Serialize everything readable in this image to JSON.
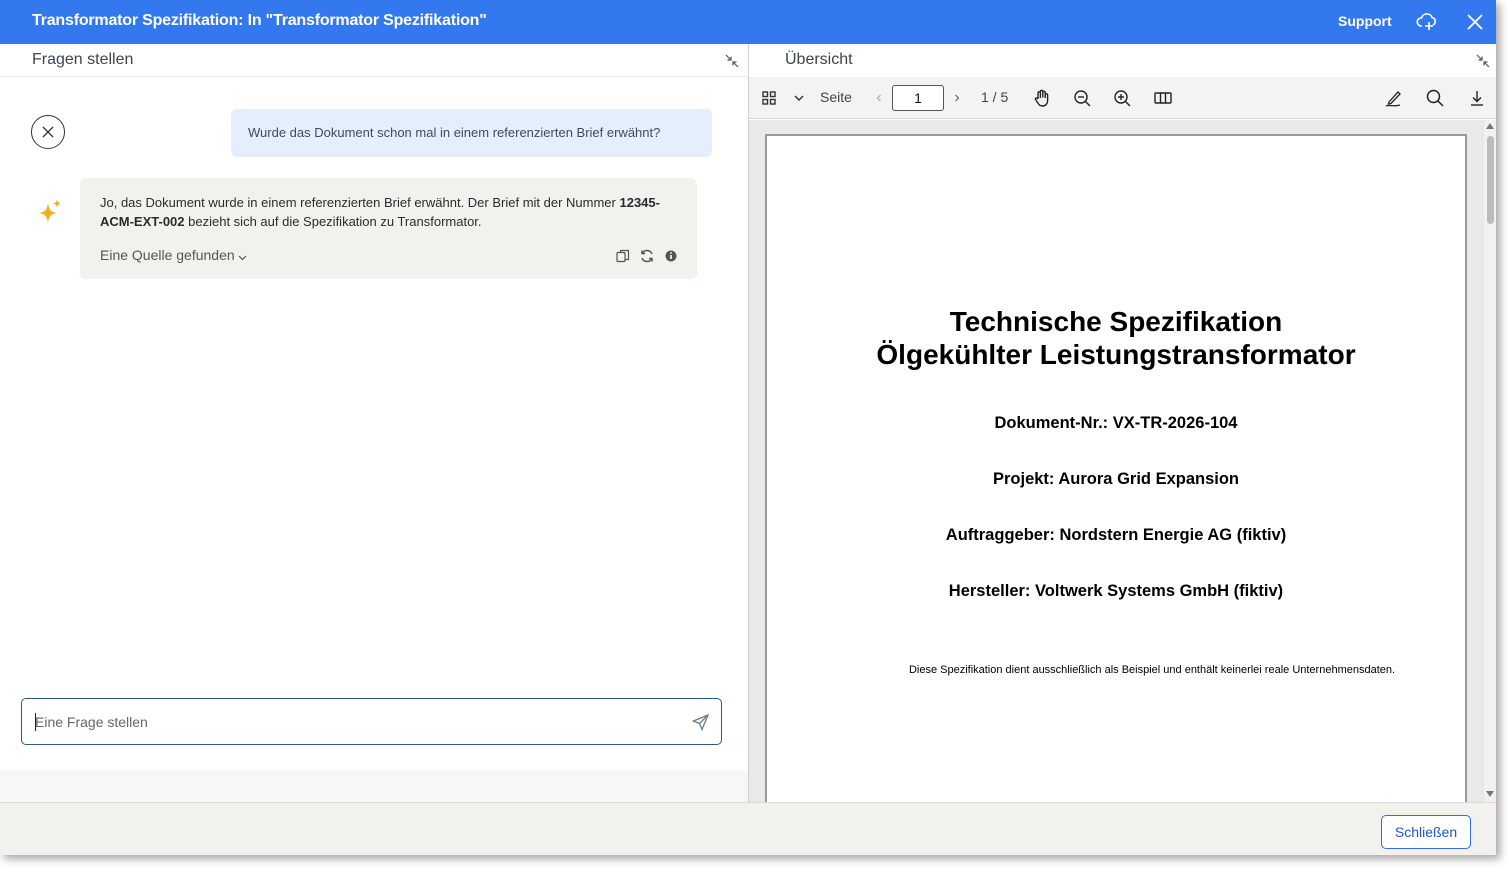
{
  "window": {
    "title": "Transformator Spezifikation: In \"Transformator Spezifikation\"",
    "support_label": "Support",
    "accent_color": "#3478f0"
  },
  "left_pane": {
    "title": "Fragen stellen",
    "user_message": "Wurde das Dokument schon mal in einem referenzierten Brief erwähnt?",
    "ai_message": {
      "text_part1": "Jo, das Dokument wurde in einem referenzierten Brief erwähnt. Der Brief mit der Nummer ",
      "reference_number": "12345-ACM-EXT-002",
      "text_part2": " bezieht sich auf die Spezifikation zu Transformator.",
      "sources_label": "Eine Quelle gefunden",
      "actions": [
        "copy-icon",
        "regenerate-icon",
        "info-icon"
      ]
    },
    "input": {
      "placeholder": "Eine Frage stellen",
      "value": ""
    }
  },
  "right_pane": {
    "title": "Übersicht",
    "toolbar": {
      "page_label": "Seite",
      "current_page": "1",
      "page_count": "1 / 5",
      "icons": [
        "grid-icon",
        "chevron-down-icon",
        "prev-page-icon",
        "next-page-icon",
        "pan-hand-icon",
        "zoom-out-icon",
        "zoom-in-icon",
        "two-page-view-icon",
        "annotate-pen-icon",
        "search-icon",
        "download-icon"
      ]
    },
    "document": {
      "title_line1": "Technische Spezifikation",
      "title_line2": "Ölgekühlter Leistungstransformator",
      "doc_number": "Dokument-Nr.: VX-TR-2026-104",
      "project": "Projekt: Aurora Grid Expansion",
      "client": "Auftraggeber: Nordstern Energie AG (fiktiv)",
      "manufacturer": "Hersteller: Voltwerk Systems GmbH (fiktiv)",
      "disclaimer": "Diese Spezifikation dient ausschließlich als Beispiel und enthält keinerlei reale Unternehmensdaten."
    }
  },
  "footer": {
    "close_label": "Schließen"
  }
}
